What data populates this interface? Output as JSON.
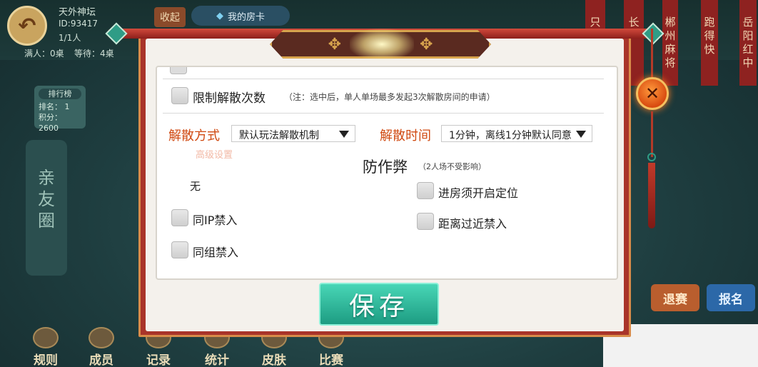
{
  "background": {
    "user_name": "天外神坛",
    "user_id": "ID:93417",
    "player_count": "1/1人",
    "tables_full": "满人：0桌",
    "tables_waiting": "等待：4桌",
    "collapse_label": "收起",
    "my_room_card_label": "我的房卡",
    "rank_list": {
      "title": "排行榜",
      "rank": "排名：  1",
      "score": "积分：2600"
    },
    "friend_circle_label": "亲友圈",
    "right_columns": [
      "只",
      "长",
      "郴州麻将",
      "跑得快",
      "岳阳红中"
    ],
    "bottom_nav": [
      "规则",
      "成员",
      "记录",
      "统计",
      "皮肤",
      "比赛"
    ],
    "exit_label": "退赛",
    "signup_label": "报名"
  },
  "dialog": {
    "close_glyph": "✕",
    "limit_dissolve": {
      "label": "限制解散次数",
      "note": "（注：选中后，单人单场最多发起3次解散房间的申请）"
    },
    "dissolve_method": {
      "label": "解散方式",
      "value": "默认玩法解散机制"
    },
    "dissolve_time": {
      "label": "解散时间",
      "value": "1分钟，离线1分钟默认同意"
    },
    "advanced_settings_label": "高级设置",
    "advanced_value": "无",
    "anti_cheat": {
      "title": "防作弊",
      "note": "（2人场不受影响）"
    },
    "options_left": [
      "同IP禁入",
      "同组禁入"
    ],
    "options_right": [
      "进房须开启定位",
      "距离过近禁入"
    ],
    "save_label": "保存"
  },
  "colors": {
    "accent_orange": "#d04a12",
    "save_green": "#1d9c82",
    "frame_red": "#a9342a"
  }
}
